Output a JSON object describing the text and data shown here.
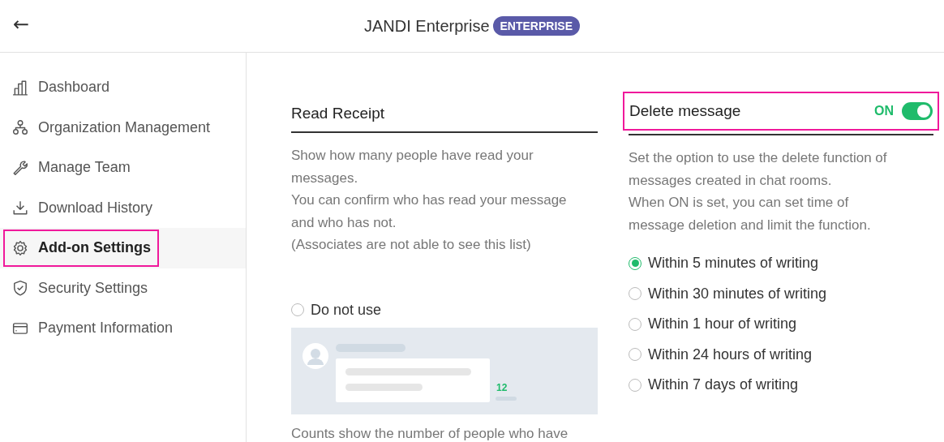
{
  "header": {
    "back": "←",
    "title": "JANDI Enterprise",
    "badge": "ENTERPRISE"
  },
  "sidebar": {
    "items": [
      {
        "label": "Dashboard",
        "selected": false,
        "highlighted": false
      },
      {
        "label": "Organization Management",
        "selected": false,
        "highlighted": false
      },
      {
        "label": "Manage Team",
        "selected": false,
        "highlighted": false
      },
      {
        "label": "Download History",
        "selected": false,
        "highlighted": false
      },
      {
        "label": "Add-on Settings",
        "selected": true,
        "highlighted": true
      },
      {
        "label": "Security Settings",
        "selected": false,
        "highlighted": false
      },
      {
        "label": "Payment Information",
        "selected": false,
        "highlighted": false
      }
    ]
  },
  "read_receipt": {
    "title": "Read Receipt",
    "description": [
      "Show how many people have read your messages.",
      "You can confirm who has read your message and who has not.",
      "(Associates are not able to see this list)"
    ],
    "option": {
      "label": "Do not use",
      "selected": false
    },
    "preview": {
      "count": "12"
    },
    "footnote": "Counts show the number of people who have"
  },
  "delete_message": {
    "title": "Delete message",
    "highlighted": true,
    "toggle": {
      "label": "ON",
      "on": true
    },
    "description": [
      "Set the option to use the delete function of messages created in chat rooms.",
      "When ON is set, you can set time of message deletion and limit the function."
    ],
    "options": [
      {
        "label": "Within 5 minutes of writing",
        "selected": true
      },
      {
        "label": "Within 30 minutes of writing",
        "selected": false
      },
      {
        "label": "Within 1 hour of writing",
        "selected": false
      },
      {
        "label": "Within 24 hours of writing",
        "selected": false
      },
      {
        "label": "Within 7 days of writing",
        "selected": false
      }
    ]
  }
}
